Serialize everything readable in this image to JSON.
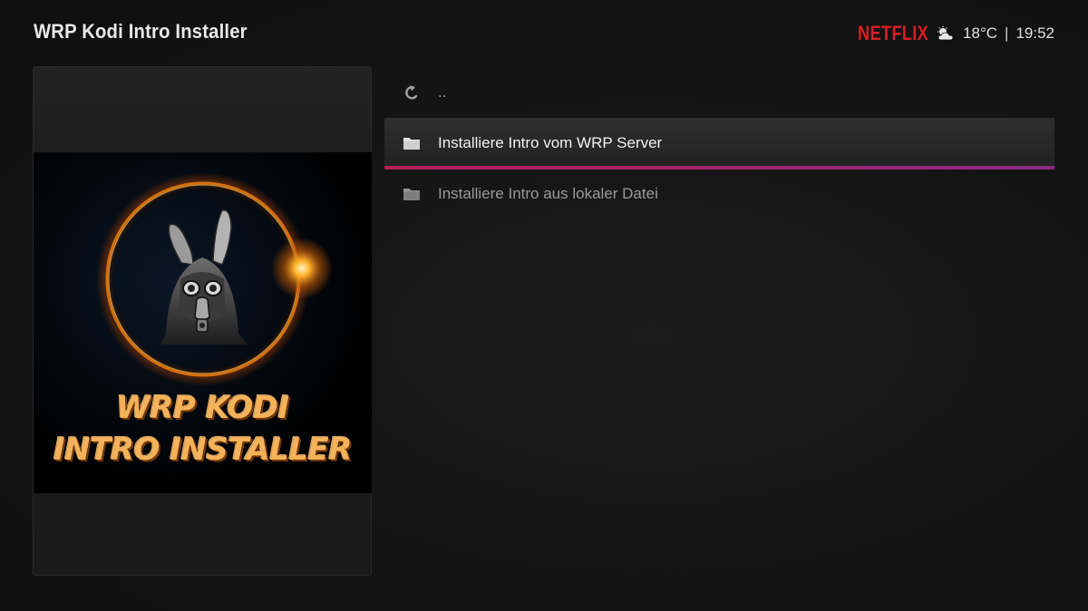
{
  "header": {
    "title": "WRP Kodi Intro Installer",
    "brand": "NETFLIX",
    "temperature": "18°C",
    "separator": "|",
    "time": "19:52",
    "weather_icon": "partly-cloudy-icon"
  },
  "thumbnail": {
    "art_line1": "WRP KODI",
    "art_line2": "INTRO INSTALLER"
  },
  "list": {
    "items": [
      {
        "label": "..",
        "icon": "back-arrow-icon"
      },
      {
        "label": "Installiere Intro vom WRP Server",
        "icon": "folder-icon",
        "selected": true
      },
      {
        "label": "Installiere Intro aus lokaler Datei",
        "icon": "folder-icon"
      }
    ]
  },
  "colors": {
    "brand_red": "#d81f26",
    "accent_start": "#b81f57",
    "accent_end": "#8f2a86",
    "art_text": "#f4b25b"
  }
}
